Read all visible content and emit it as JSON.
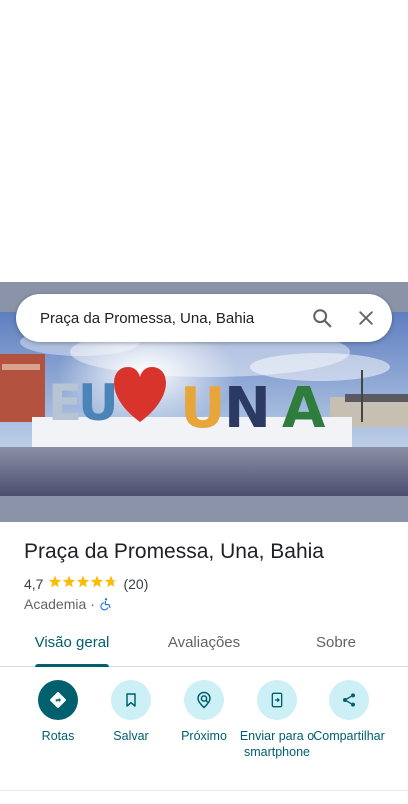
{
  "search": {
    "query": "Praça da Promessa, Una, Bahia",
    "search_icon": "search-icon",
    "close_icon": "close-icon"
  },
  "place": {
    "title": "Praça da Promessa, Una, Bahia",
    "rating": "4,7",
    "stars_value": 4.7,
    "stars_max": 5,
    "reviews_count": "(20)",
    "category": "Academia",
    "accessibility_icon": "wheelchair-icon"
  },
  "tabs": [
    {
      "label": "Visão geral",
      "active": true
    },
    {
      "label": "Avaliações",
      "active": false
    },
    {
      "label": "Sobre",
      "active": false
    }
  ],
  "actions": [
    {
      "label": "Rotas",
      "icon": "directions-icon"
    },
    {
      "label": "Salvar",
      "icon": "bookmark-icon"
    },
    {
      "label": "Próximo",
      "icon": "nearby-icon"
    },
    {
      "label": "Enviar para o smartphone",
      "icon": "send-to-phone-icon"
    },
    {
      "label": "Compartilhar",
      "icon": "share-icon"
    }
  ],
  "colors": {
    "accent": "#00606d",
    "chip_bg": "#cdeff6",
    "star": "#fbbc04"
  }
}
